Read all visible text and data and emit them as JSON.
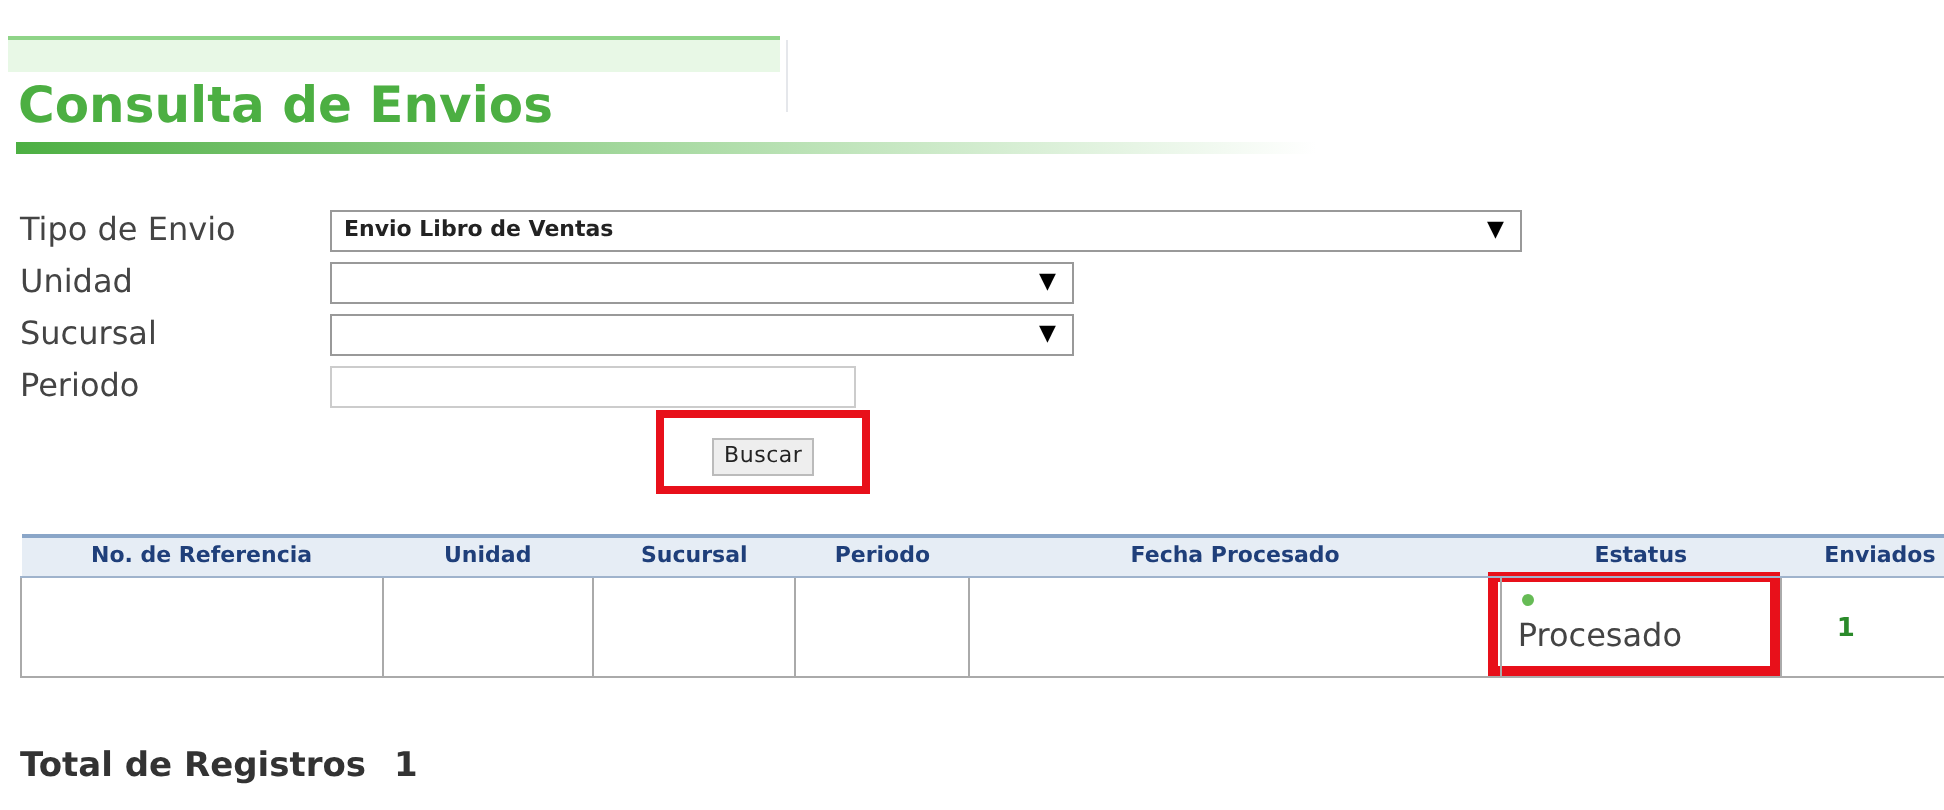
{
  "page": {
    "title": "Consulta de Envios"
  },
  "form": {
    "fields": [
      {
        "label": "Tipo de Envio",
        "kind": "select",
        "value": "Envio Libro de Ventas",
        "arrow": "▼"
      },
      {
        "label": "Unidad",
        "kind": "select",
        "arrow": "▼"
      },
      {
        "label": "Sucursal",
        "kind": "select",
        "arrow": "▼"
      },
      {
        "label": "Periodo",
        "kind": "input"
      }
    ],
    "button": {
      "label": "Buscar",
      "highlighted": true
    }
  },
  "table": {
    "columns": [
      "No. de Referencia",
      "Unidad",
      "Sucursal",
      "Periodo",
      "Fecha Procesado",
      "Estatus",
      "Enviados"
    ],
    "rows": [
      {
        "status": {
          "text": "Procesado",
          "color": "#66bb55",
          "highlighted": true
        },
        "sent": "1"
      }
    ]
  },
  "total": {
    "label": "Total de Registros",
    "value": "1"
  }
}
